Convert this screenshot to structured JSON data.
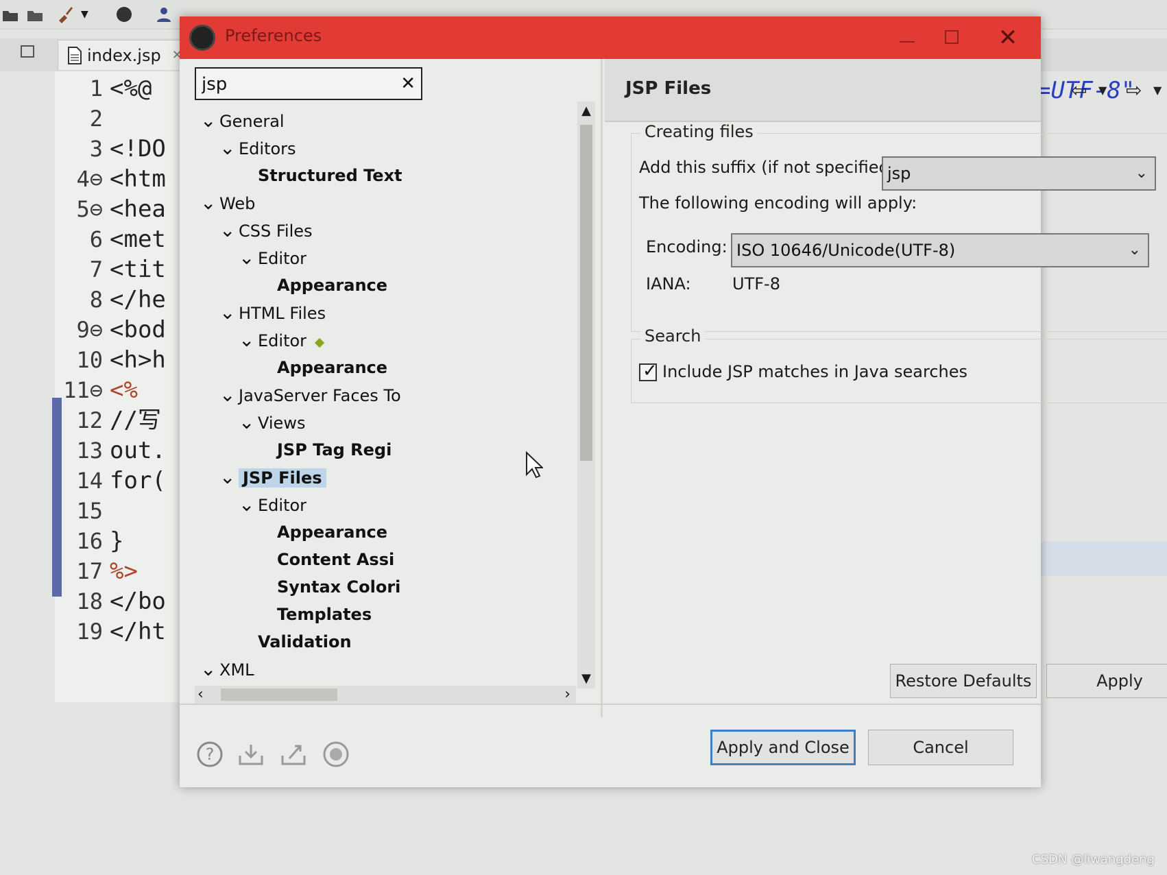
{
  "editor": {
    "tab_label": "index.jsp",
    "code_lines": [
      {
        "num": "1",
        "code": "<%@"
      },
      {
        "num": "2",
        "code": ""
      },
      {
        "num": "3",
        "code": "<!DO"
      },
      {
        "num": "4⊖",
        "code": "<htm"
      },
      {
        "num": "5⊖",
        "code": "<hea"
      },
      {
        "num": "6",
        "code": "<met"
      },
      {
        "num": "7",
        "code": "<tit"
      },
      {
        "num": "8",
        "code": "</he"
      },
      {
        "num": "9⊖",
        "code": "<bod"
      },
      {
        "num": "10",
        "code": "<h>h"
      },
      {
        "num": "11⊖",
        "code": "<%"
      },
      {
        "num": "12",
        "code": "//写"
      },
      {
        "num": "13",
        "code": "out."
      },
      {
        "num": "14",
        "code": "for("
      },
      {
        "num": "15",
        "code": ""
      },
      {
        "num": "16",
        "code": "}"
      },
      {
        "num": "17",
        "code": "%>"
      },
      {
        "num": "18",
        "code": "</bo"
      },
      {
        "num": "19",
        "code": "</ht"
      }
    ],
    "right_fragment": "=UTF-8\""
  },
  "dialog": {
    "title": "Preferences",
    "filter_value": "jsp",
    "tree": [
      {
        "label": "General",
        "level": 0,
        "expanded": true
      },
      {
        "label": "Editors",
        "level": 1,
        "expanded": true
      },
      {
        "label": "Structured Text",
        "level": 2,
        "leaf": true
      },
      {
        "label": "Web",
        "level": 0,
        "expanded": true
      },
      {
        "label": "CSS Files",
        "level": 1,
        "expanded": true
      },
      {
        "label": "Editor",
        "level": 2,
        "expanded": true
      },
      {
        "label": "Appearance",
        "level": 3,
        "leaf": true
      },
      {
        "label": "HTML Files",
        "level": 1,
        "expanded": true
      },
      {
        "label": "Editor",
        "level": 2,
        "expanded": true,
        "modified": true
      },
      {
        "label": "Appearance",
        "level": 3,
        "leaf": true
      },
      {
        "label": "JavaServer Faces To",
        "level": 1,
        "expanded": true
      },
      {
        "label": "Views",
        "level": 2,
        "expanded": true
      },
      {
        "label": "JSP Tag Regi",
        "level": 3,
        "leaf": true
      },
      {
        "label": "JSP Files",
        "level": 1,
        "expanded": true,
        "selected": true
      },
      {
        "label": "Editor",
        "level": 2,
        "expanded": true
      },
      {
        "label": "Appearance",
        "level": 3,
        "leaf": true
      },
      {
        "label": "Content Assi",
        "level": 3,
        "leaf": true
      },
      {
        "label": "Syntax Colori",
        "level": 3,
        "leaf": true
      },
      {
        "label": "Templates",
        "level": 3,
        "leaf": true
      },
      {
        "label": "Validation",
        "level": 2,
        "leaf": true
      },
      {
        "label": "XML",
        "level": 0,
        "expanded": true
      }
    ],
    "page": {
      "title": "JSP Files",
      "creating_files": {
        "group_title": "Creating files",
        "suffix_label": "Add this suffix (if not specified):",
        "suffix_value": "jsp",
        "encoding_intro": "The following encoding will apply:",
        "encoding_label": "Encoding:",
        "encoding_value": "ISO 10646/Unicode(UTF-8)",
        "iana_label": "IANA:",
        "iana_value": "UTF-8"
      },
      "search": {
        "group_title": "Search",
        "include_label": "Include JSP matches in Java searches",
        "include_checked": true
      }
    },
    "buttons": {
      "restore_defaults": "Restore Defaults",
      "apply": "Apply",
      "apply_and_close": "Apply and Close",
      "cancel": "Cancel"
    }
  },
  "watermark": "CSDN @liwangdeng",
  "colors": {
    "titlebar": "#e23a35",
    "selection": "#bed4e8",
    "default_button_border": "#3d7fc4",
    "code_keyword": "#2a3fc0"
  }
}
